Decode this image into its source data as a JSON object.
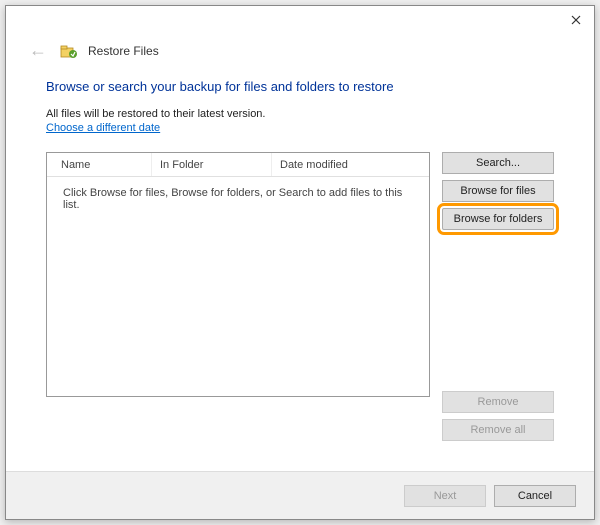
{
  "window": {
    "title": "Restore Files"
  },
  "heading": "Browse or search your backup for files and folders to restore",
  "info": "All files will be restored to their latest version.",
  "link": "Choose a different date",
  "columns": {
    "name": "Name",
    "folder": "In Folder",
    "date": "Date modified"
  },
  "empty_message": "Click Browse for files, Browse for folders, or Search to add files to this list.",
  "buttons": {
    "search": "Search...",
    "browse_files": "Browse for files",
    "browse_folders": "Browse for folders",
    "remove": "Remove",
    "remove_all": "Remove all",
    "next": "Next",
    "cancel": "Cancel"
  }
}
